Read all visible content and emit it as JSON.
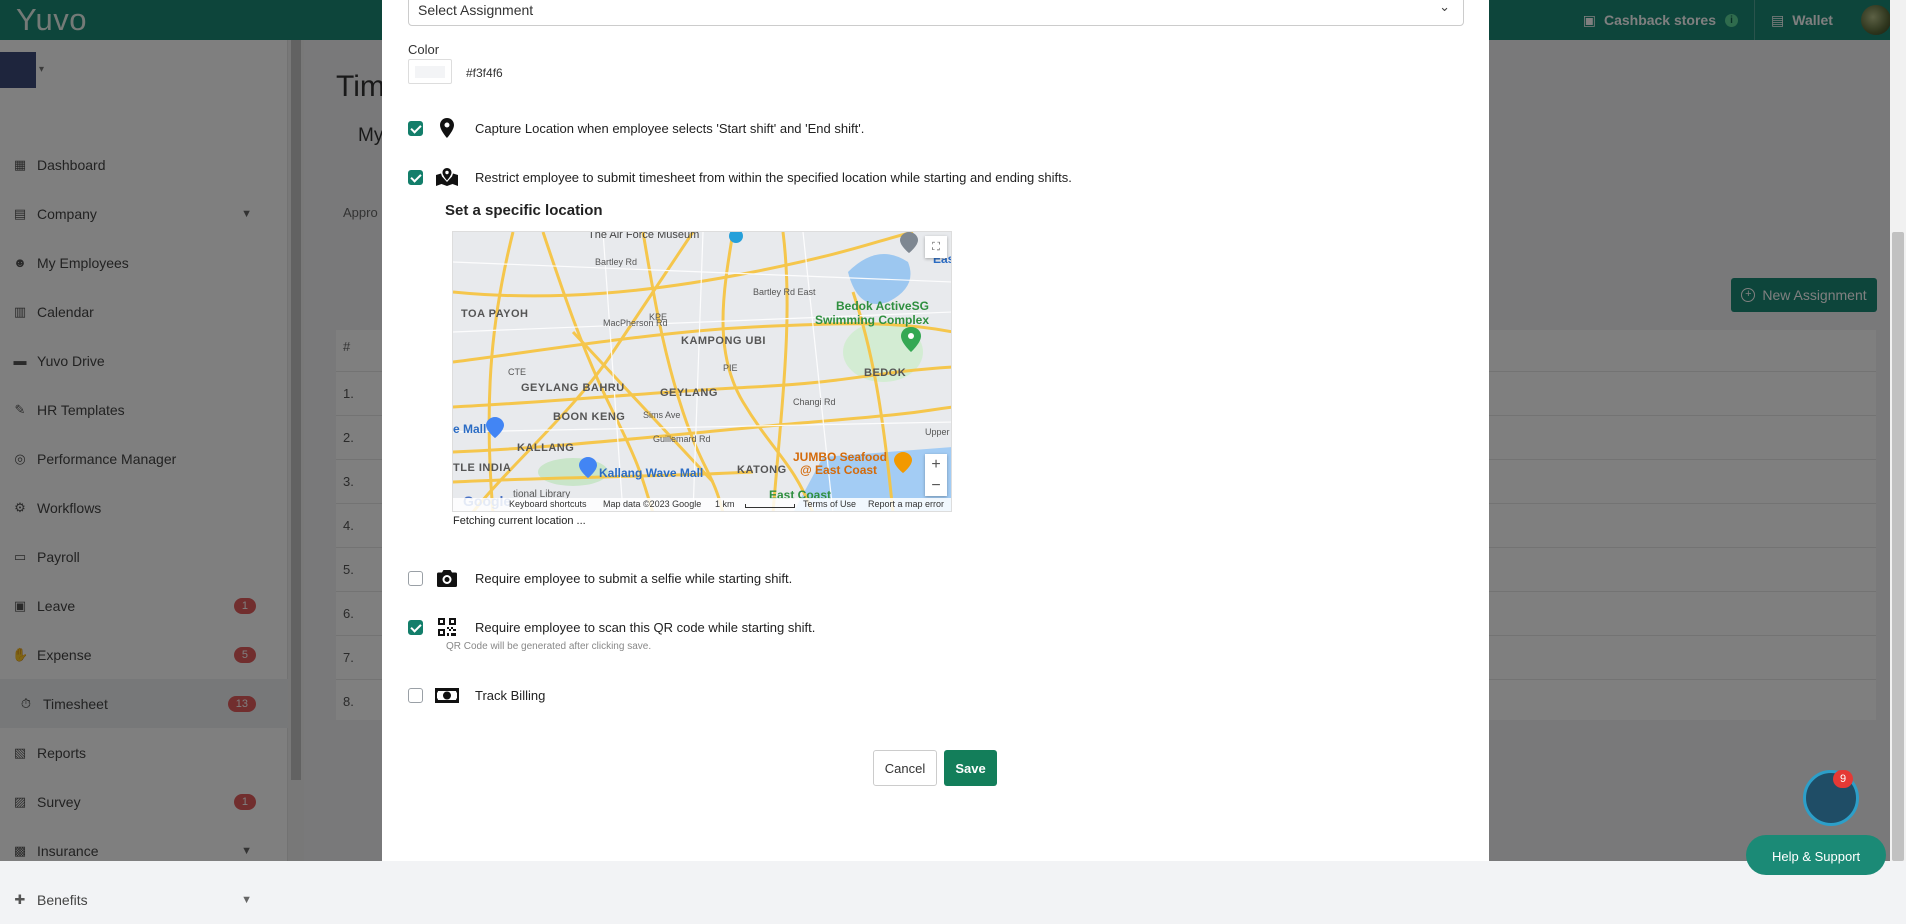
{
  "app": {
    "logo": "Yuvo"
  },
  "topbar": {
    "cashback_label": "Cashback stores",
    "cashback_info": "i",
    "wallet_label": "Wallet"
  },
  "sidebar": {
    "items": [
      {
        "label": "Dashboard",
        "icon": "dashboard-icon"
      },
      {
        "label": "Company",
        "icon": "building-icon",
        "expandable": true
      },
      {
        "label": "My Employees",
        "icon": "users-icon"
      },
      {
        "label": "Calendar",
        "icon": "calendar-icon"
      },
      {
        "label": "Yuvo Drive",
        "icon": "folder-icon"
      },
      {
        "label": "HR Templates",
        "icon": "edit-icon"
      },
      {
        "label": "Performance Manager",
        "icon": "target-icon"
      },
      {
        "label": "Workflows",
        "icon": "cogs-icon"
      },
      {
        "label": "Payroll",
        "icon": "money-icon"
      },
      {
        "label": "Leave",
        "icon": "calendar-check-icon",
        "badge": "1"
      },
      {
        "label": "Expense",
        "icon": "hand-coin-icon",
        "badge": "5"
      },
      {
        "label": "Timesheet",
        "icon": "stopwatch-icon",
        "badge": "13",
        "active": true
      },
      {
        "label": "Reports",
        "icon": "report-icon"
      },
      {
        "label": "Survey",
        "icon": "survey-icon",
        "badge": "1"
      },
      {
        "label": "Insurance",
        "icon": "insurance-icon",
        "expandable": true
      },
      {
        "label": "Benefits",
        "icon": "gift-icon",
        "expandable": true
      }
    ]
  },
  "background_page": {
    "title": "Tim",
    "tab": "My",
    "subtab": "Appro",
    "table_hash": "#",
    "rows": [
      "1.",
      "2.",
      "3.",
      "4.",
      "5.",
      "6.",
      "7.",
      "8."
    ],
    "new_assignment_label": "New Assignment"
  },
  "modal": {
    "assignment_select": {
      "value": "Select Assignment"
    },
    "color": {
      "label": "Color",
      "value": "#f3f4f6"
    },
    "options": {
      "capture_location": {
        "checked": true,
        "icon": "map-pin-icon",
        "label": "Capture Location when employee selects 'Start shift' and 'End shift'."
      },
      "restrict_location": {
        "checked": true,
        "icon": "map-marked-icon",
        "label": "Restrict employee to submit timesheet from within the specified location while starting and ending shifts."
      },
      "selfie": {
        "checked": false,
        "icon": "camera-icon",
        "label": "Require employee to submit a selfie while starting shift."
      },
      "qr_code": {
        "checked": true,
        "icon": "qrcode-icon",
        "label": "Require employee to scan this QR code while starting shift.",
        "note": "QR Code will be generated after clicking save."
      },
      "track_billing": {
        "checked": false,
        "icon": "money-bill-icon",
        "label": "Track Billing"
      }
    },
    "location": {
      "title": "Set a specific location",
      "status": "Fetching current location ...",
      "map": {
        "labels": {
          "air_force": "The Air Force Museum",
          "bartley_rd": "Bartley Rd",
          "bartley_rd_east": "Bartley Rd East",
          "bedok_activesg": "Bedok ActiveSG",
          "swimming_complex": "Swimming Complex",
          "toa_payoh": "TOA PAYOH",
          "macpherson": "MacPherson Rd",
          "kampong_ubi": "KAMPONG UBI",
          "bedok": "BEDOK",
          "geylang_bahru": "GEYLANG BAHRU",
          "geylang": "GEYLANG",
          "boon_keng": "BOON KENG",
          "kallang": "KALLANG",
          "kallang_wave": "Kallang Wave Mall",
          "katong": "KATONG",
          "jumbo_1": "JUMBO Seafood",
          "jumbo_2": "@ East Coast",
          "east_coast": "East Coast",
          "little_india": "TLE INDIA",
          "mall": "e Mall",
          "sims_ave": "Sims Ave",
          "guillemard": "Guillemard Rd",
          "changi_rd": "Changi Rd",
          "upper": "Upper",
          "eas": "Eas",
          "cte": "CTE",
          "pie": "PIE",
          "kpe": "KPE",
          "national_library": "tional Library",
          "google": "Google"
        },
        "footer": {
          "shortcuts": "Keyboard shortcuts",
          "mapdata": "Map data ©2023 Google",
          "scale": "1 km",
          "terms": "Terms of Use",
          "report": "Report a map error"
        },
        "zoom_in": "+",
        "zoom_out": "−",
        "fullscreen": "⛶"
      }
    },
    "buttons": {
      "cancel": "Cancel",
      "save": "Save"
    }
  },
  "help": {
    "badge": "9",
    "label": "Help & Support"
  },
  "colors": {
    "brand": "#1b8a76",
    "save": "#137e5a",
    "checkbox": "#137e6a"
  }
}
